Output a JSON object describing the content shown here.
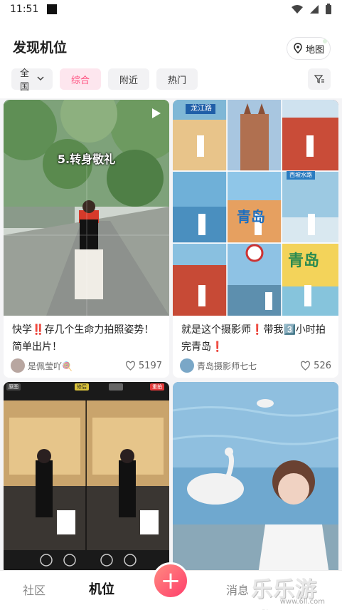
{
  "status_bar": {
    "time": "11:51"
  },
  "header": {
    "title": "发现机位",
    "map_label": "地图"
  },
  "filters": {
    "region": "全国",
    "tabs": [
      "综合",
      "附近",
      "热门"
    ],
    "active_index": 0
  },
  "cards": [
    {
      "overlay": "5.转身敬礼",
      "caption_a": "快学",
      "caption_mark": "‼️",
      "caption_b": "存几个生命力拍照姿势！简单出片！",
      "author": "是佩莹吖🍭",
      "likes": "5197"
    },
    {
      "caption_a": "就是这个摄影师",
      "caption_mark": "❗",
      "caption_b": "带我",
      "caption_num": "3️⃣",
      "caption_c": "小时拍完青岛",
      "caption_mark2": "❗",
      "author": "青岛摄影师七七",
      "likes": "526",
      "sign_top": "龙江路",
      "sign_mid": "西坡水路",
      "big_char": "青岛",
      "big_char2": "青岛"
    },
    {
      "label_a": "原图",
      "label_b": "修后",
      "label_c": "重拍"
    },
    {}
  ],
  "tabbar": {
    "items": [
      "社区",
      "机位",
      "消息"
    ],
    "active_index": 1,
    "fab": "+"
  },
  "watermark": {
    "text": "乐乐游戏",
    "url": "www.6ll.com"
  },
  "colors": {
    "accent": "#ff4f7f",
    "chip_active_bg": "#fde6ee"
  }
}
